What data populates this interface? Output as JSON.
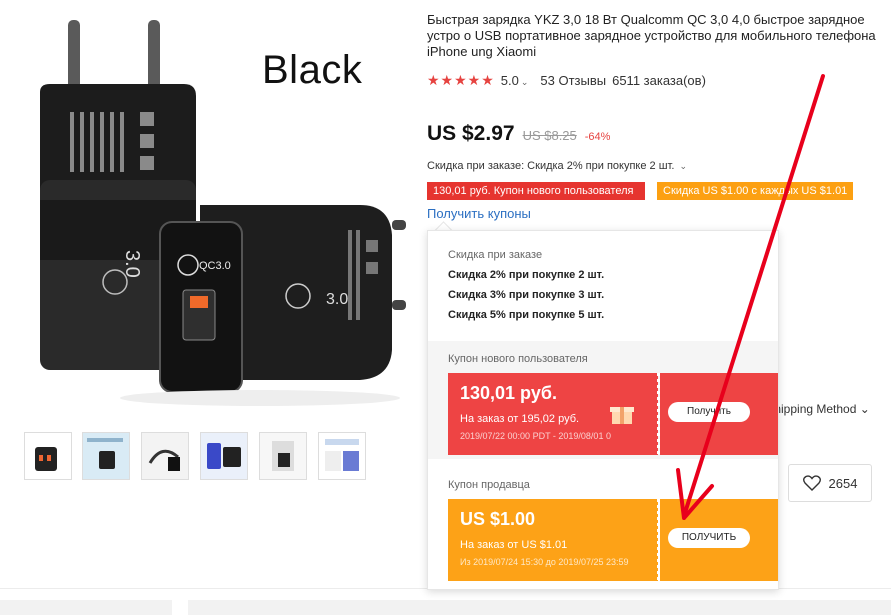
{
  "product": {
    "image_caption": "Black",
    "thumbnails": 6
  },
  "title": "Быстрая зарядка YKZ 3,0 18 Вт Qualcomm QC 3,0 4,0 быстрое зарядное устро о USB портативное зарядное устройство для мобильного телефона iPhone ung Xiaomi",
  "rating": {
    "stars": "★★★★★",
    "score": "5.0",
    "reviews": "53 Отзывы",
    "orders": "6511 заказа(ов)"
  },
  "price": {
    "current": "US $2.97",
    "old": "US $8.25",
    "discount": "-64%"
  },
  "bulk_discount_line": "Скидка при заказе: Скидка 2% при покупке 2 шт.",
  "chips": {
    "new_user": "130,01 руб. Купон нового пользователя",
    "seller": "Скидка US $1.00 с каждых US $1.01"
  },
  "get_coupons_link": "Получить купоны",
  "dropdown": {
    "bulk_title": "Скидка при заказе",
    "tiers": [
      "Скидка 2% при покупке 2 шт.",
      "Скидка 3% при покупке 3 шт.",
      "Скидка 5% при покупке 5 шт."
    ],
    "new_user_title": "Купон нового пользователя",
    "new_user_coupon": {
      "amount": "130,01 руб.",
      "min_order": "На заказ от  195,02 руб.",
      "dates": "2019/07/22 00:00 PDT - 2019/08/01 0",
      "button": "Получить"
    },
    "seller_title": "Купон продавца",
    "seller_coupon": {
      "amount": "US $1.00",
      "min_order": "На заказ от  US $1.01",
      "dates": "Из 2019/07/24 15:30 до 2019/07/25 23:59",
      "button": "ПОЛУЧИТЬ"
    }
  },
  "shipping_method": "s Shipping Method",
  "wishlist_count": "2654",
  "colors": {
    "red": "#e6342f",
    "orange": "#fca012",
    "link": "#2b6fc2",
    "arrow": "#e8001c"
  }
}
